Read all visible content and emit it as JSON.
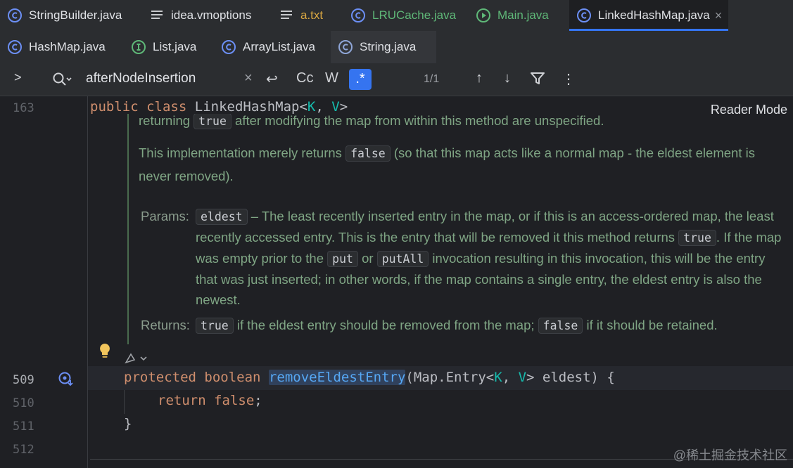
{
  "tabs_row1": [
    {
      "label": "StringBuilder.java",
      "icon": "class-icon",
      "state": "normal"
    },
    {
      "label": "idea.vmoptions",
      "icon": "text-file-icon",
      "state": "normal"
    },
    {
      "label": "a.txt",
      "icon": "text-file-icon",
      "state": "warn"
    },
    {
      "label": "LRUCache.java",
      "icon": "class-icon",
      "state": "modified"
    },
    {
      "label": "Main.java",
      "icon": "runnable-class-icon",
      "state": "modified"
    },
    {
      "label": "LinkedHashMap.java",
      "icon": "class-icon",
      "state": "active",
      "close": "×"
    }
  ],
  "tabs_row2": [
    {
      "label": "HashMap.java",
      "icon": "class-icon"
    },
    {
      "label": "List.java",
      "icon": "interface-icon"
    },
    {
      "label": "ArrayList.java",
      "icon": "class-icon"
    },
    {
      "label": "String.java",
      "icon": "class-icon"
    }
  ],
  "search": {
    "expand": ">",
    "query": "afterNodeInsertion",
    "clear": "×",
    "newline": "↩",
    "match_case": "Cc",
    "words": "W",
    "regex": ".*",
    "count": "1/1",
    "prev": "↑",
    "next": "↓",
    "more": "⋮"
  },
  "editor": {
    "reader_mode": "Reader Mode",
    "sticky": {
      "line": "163",
      "kw1": "public",
      "kw2": "class",
      "name": "LinkedHashMap",
      "lt": "<",
      "k": "K",
      "comma": ", ",
      "v": "V",
      "gt": ">"
    },
    "doc": {
      "line1_pre": "returning ",
      "line1_code": "true",
      "line1_post": " after modifying the map from within this method are unspecified.",
      "p2_pre": "This implementation merely returns ",
      "p2_code": "false",
      "p2_post1": " (so that this map acts like a normal map - the eldest element is",
      "p2_post2": "never removed).",
      "params_label": "Params:",
      "param_name": "eldest",
      "param_t1": " – The least recently inserted entry in the map, or if this is an access-ordered map, the least recently accessed entry. This is the entry that will be removed it this method returns ",
      "param_code_true": "true",
      "param_t2": ". If the map was empty prior to the ",
      "param_code_put": "put",
      "param_t3": " or ",
      "param_code_putall": "putAll",
      "param_t4": " invocation resulting in this invocation, this will be the entry that was just inserted; in other words, if the map contains a single entry, the eldest entry is also the newest.",
      "returns_label": "Returns:",
      "ret_code_true": "true",
      "ret_t1": " if the eldest entry should be removed from the map; ",
      "ret_code_false": "false",
      "ret_t2": " if it should be retained."
    },
    "lines": [
      {
        "num": "509"
      },
      {
        "num": "510"
      },
      {
        "num": "511"
      },
      {
        "num": "512"
      }
    ],
    "code509": {
      "kw1": "protected",
      "kw2": "boolean",
      "fn": "removeEldestEntry",
      "p1": "(Map.Entry<",
      "k": "K",
      ",": ", ",
      "v": "V",
      "p2": "> eldest) {"
    },
    "code510": {
      "kw": "return",
      "kw2": "false",
      "semi": ";"
    },
    "code511": {
      "brace": "}"
    },
    "watermark": "@稀土掘金技术社区"
  },
  "colors": {
    "accent": "#3574f0",
    "keyword": "#cf8e6d",
    "function": "#56a8f5",
    "generic": "#16baac",
    "doc": "#7fa584"
  }
}
